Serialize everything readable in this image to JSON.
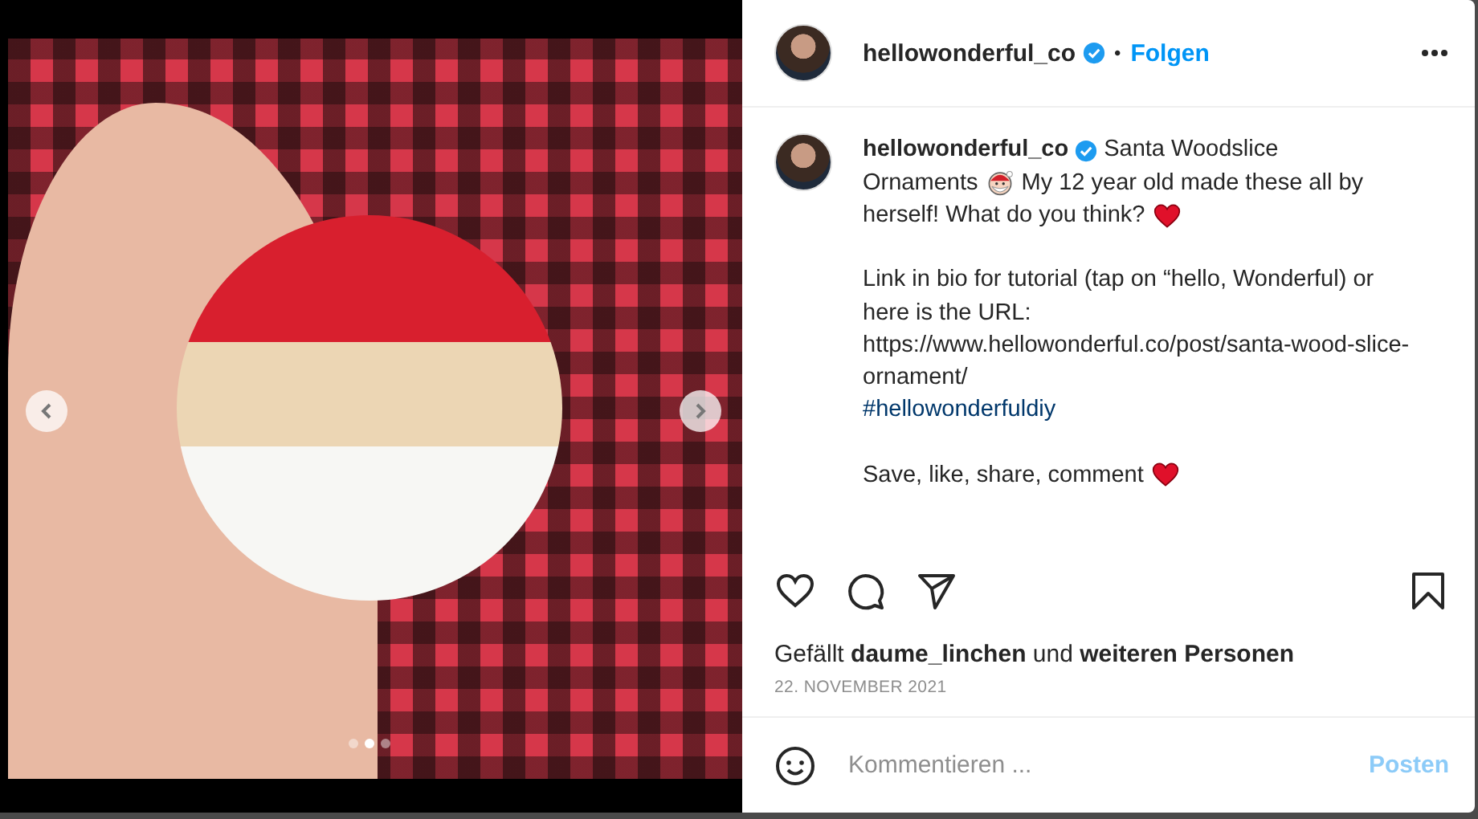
{
  "media": {
    "dots": [
      {
        "selected": false
      },
      {
        "selected": true
      },
      {
        "selected": false
      }
    ]
  },
  "header": {
    "username": "hellowonderful_co",
    "verified": true,
    "separator": "•",
    "follow": "Folgen"
  },
  "caption": {
    "username": "hellowonderful_co",
    "verified": true,
    "lines": [
      [
        {
          "kind": "user"
        },
        {
          "kind": "badge"
        },
        {
          "kind": "text",
          "text": "Santa Woodslice"
        }
      ],
      [
        {
          "kind": "text",
          "text": "Ornaments"
        },
        {
          "kind": "santa"
        },
        {
          "kind": "text",
          "text": "My 12 year old made these all by"
        }
      ],
      [
        {
          "kind": "text",
          "text": "herself! What do you think?"
        },
        {
          "kind": "heart"
        }
      ]
    ],
    "info": "Link in bio for tutorial (tap on “hello, Wonderful) or here is the URL:",
    "url": "https://www.hellowonderful.co/post/santa-wood-slice-ornament/",
    "hashtag": "#hellowonderfuldiy",
    "closing": "Save, like, share, comment"
  },
  "likes": "Gefällt **daume_linchen** und **weiteren Personen**",
  "date": "22. NOVEMBER 2021",
  "comment": {
    "placeholder": "Kommentieren ...",
    "post_button": "Posten",
    "post_disabled": true
  }
}
